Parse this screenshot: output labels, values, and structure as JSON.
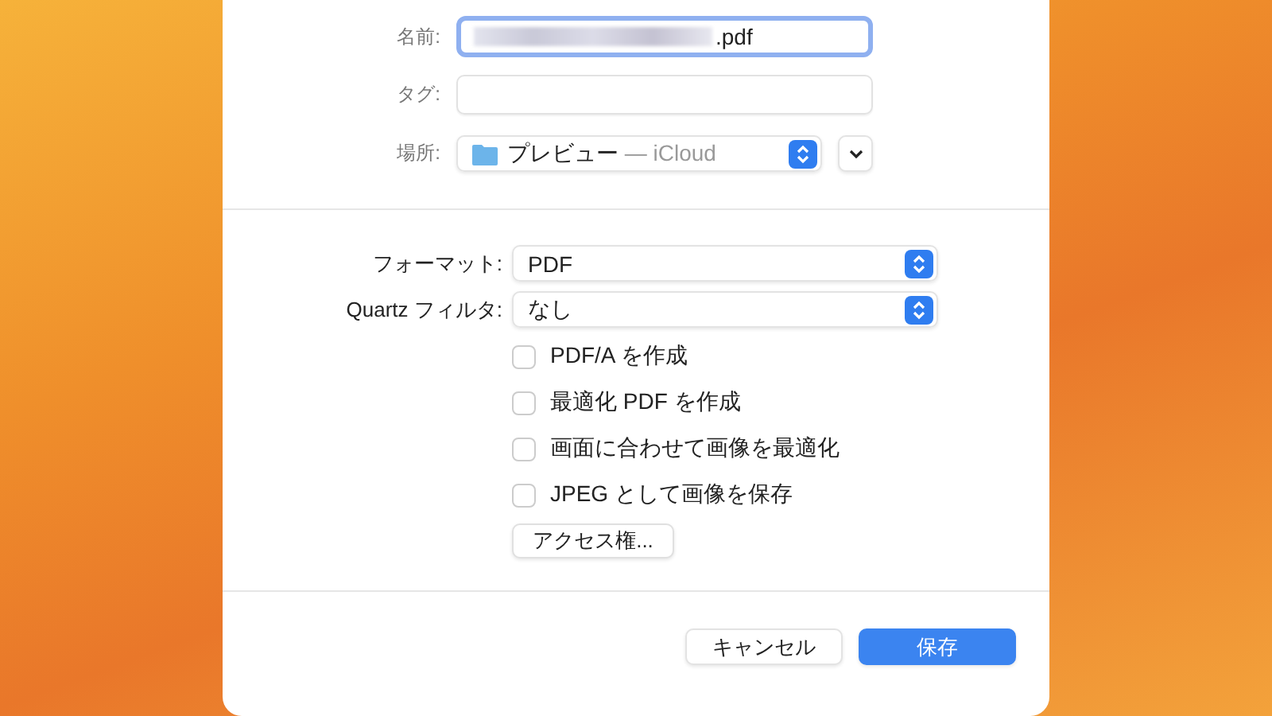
{
  "dialog": {
    "name_field": {
      "label": "名前:",
      "value": ".pdf",
      "focused": true
    },
    "tags_field": {
      "label": "タグ:"
    },
    "location": {
      "label": "場所:",
      "folder": "プレビュー",
      "service": "— iCloud"
    },
    "format": {
      "label": "フォーマット:",
      "value": "PDF"
    },
    "quartz_filter": {
      "label": "Quartz フィルタ:",
      "value": "なし"
    },
    "options": [
      {
        "label": "PDF/A を作成",
        "checked": false
      },
      {
        "label": "最適化 PDF を作成",
        "checked": false
      },
      {
        "label": "画面に合わせて画像を最適化",
        "checked": false
      },
      {
        "label": "JPEG として画像を保存",
        "checked": false
      }
    ],
    "access_button": "アクセス権...",
    "buttons": [
      {
        "label": "キャンセル",
        "kind": "secondary"
      },
      {
        "label": "保存",
        "kind": "primary"
      }
    ]
  }
}
